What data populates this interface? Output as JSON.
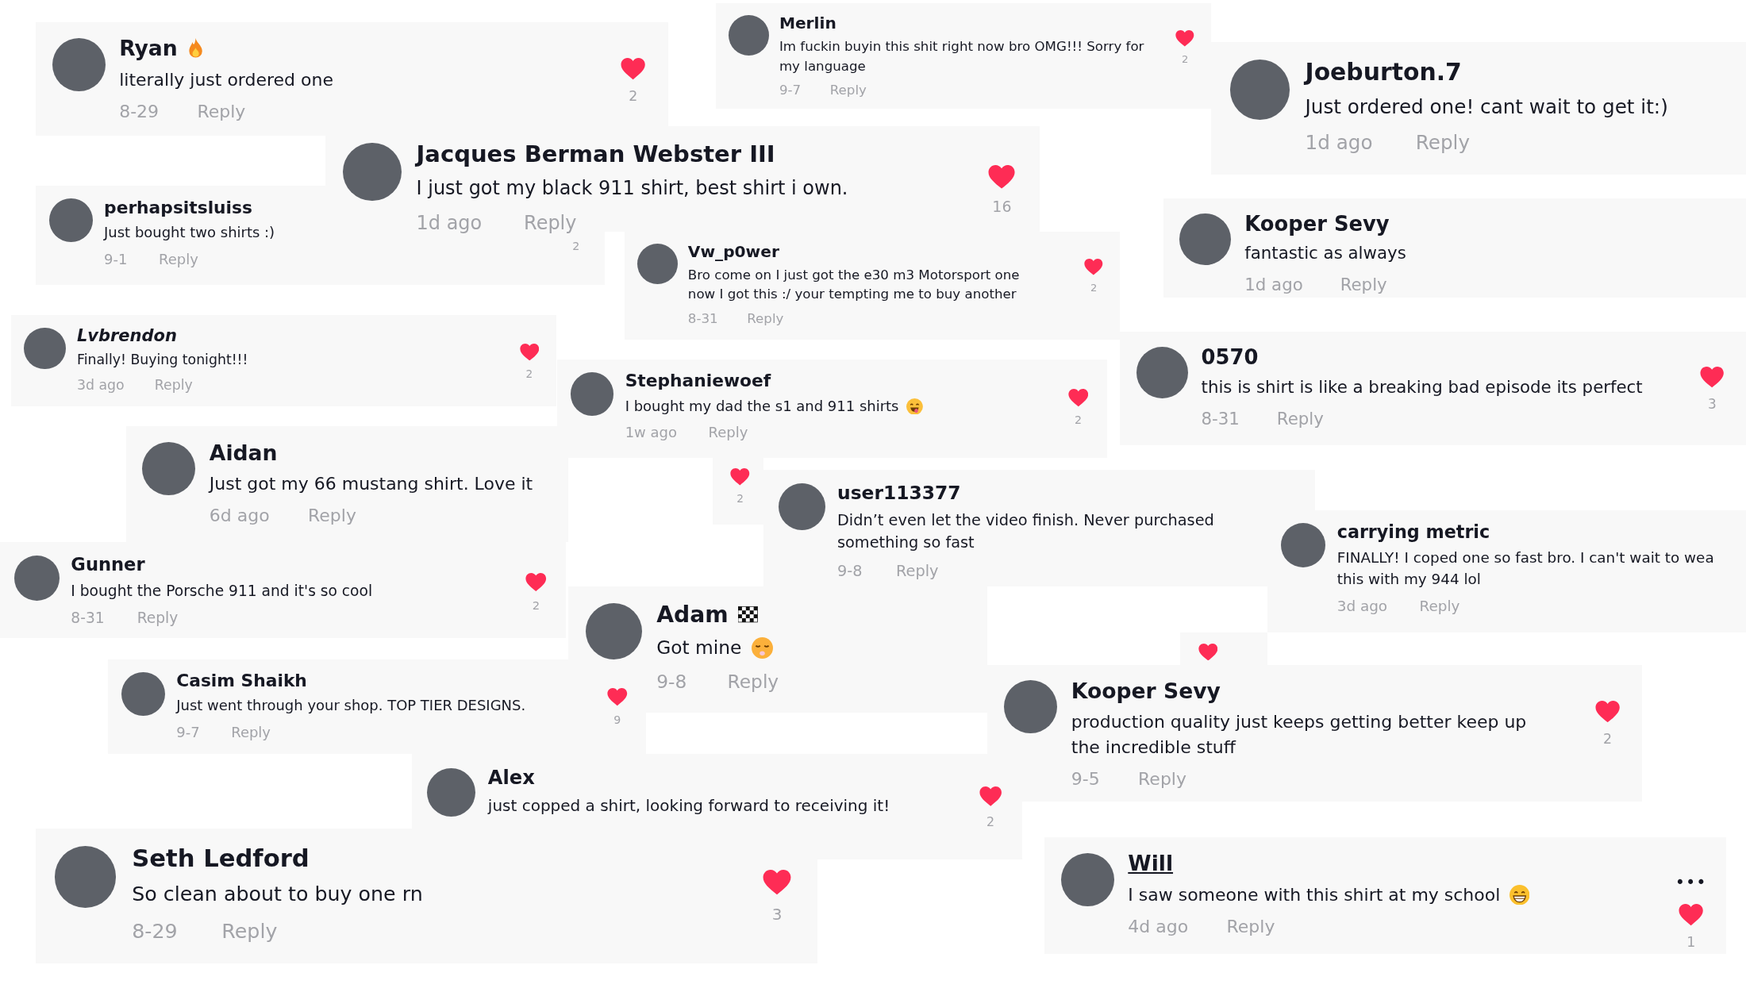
{
  "comments": [
    {
      "kind": "comment",
      "name": "Ryan",
      "name_badge": {
        "kind": "flame"
      },
      "text": "literally just ordered one",
      "date": "8-29",
      "reply": "Reply",
      "likes": {
        "heart": true,
        "count": "2"
      }
    },
    {
      "kind": "comment",
      "name": "Merlin",
      "text": "Im fuckin buyin this shit right now bro OMG!!! Sorry for\nmy language",
      "date": "9-7",
      "reply": "Reply",
      "likes": {
        "heart": true,
        "count": "2"
      }
    },
    {
      "kind": "comment",
      "name": "Joeburton.7",
      "text": "Just ordered one! cant wait to get it:)",
      "date": "1d ago",
      "reply": "Reply"
    },
    {
      "kind": "comment",
      "name": "perhapsitsluiss",
      "text": "Just bought two shirts :)",
      "date": "9-1",
      "reply": "Reply",
      "likes": {
        "heart": false,
        "count": "2"
      }
    },
    {
      "kind": "comment",
      "name": "Jacques Berman Webster III",
      "text": "I just got my black 911 shirt, best shirt i own.",
      "date": "1d ago",
      "reply": "Reply",
      "likes": {
        "heart": true,
        "count": "16"
      }
    },
    {
      "kind": "comment",
      "name": "Vw_p0wer",
      "text": "Bro come on I just got the e30 m3 Motorsport one\nnow I got this :/ your tempting me to buy another",
      "date": "8-31",
      "reply": "Reply",
      "likes": {
        "heart": true,
        "count": "2"
      }
    },
    {
      "kind": "comment",
      "name": "Kooper Sevy",
      "text": "fantastic as always",
      "date": "1d ago",
      "reply": "Reply"
    },
    {
      "kind": "comment",
      "name": "Lvbrendon",
      "name_italic": true,
      "text": "Finally! Buying tonight!!!",
      "date": "3d ago",
      "reply": "Reply",
      "likes": {
        "heart": true,
        "count": "2"
      }
    },
    {
      "kind": "comment",
      "name": "Stephaniewoef",
      "text": "I bought my dad the s1 and 911 shirts",
      "text_emoji": {
        "kind": "tongue"
      },
      "date": "1w ago",
      "reply": "Reply",
      "likes": {
        "heart": true,
        "count": "2"
      }
    },
    {
      "kind": "comment",
      "name": "0570",
      "text": "this is shirt is like a breaking bad episode its perfect",
      "date": "8-31",
      "reply": "Reply",
      "likes": {
        "heart": true,
        "count": "3"
      }
    },
    {
      "kind": "comment",
      "name": "Aidan",
      "text": "Just got my 66 mustang shirt. Love it",
      "date": "6d ago",
      "reply": "Reply"
    },
    {
      "kind": "likes",
      "likes": {
        "heart": true,
        "count": "2"
      }
    },
    {
      "kind": "comment",
      "name": "user113377",
      "text": "Didn’t even let the video finish. Never purchased\nsomething so fast",
      "date": "9-8",
      "reply": "Reply"
    },
    {
      "kind": "comment",
      "name": "carrying metric",
      "text": "FINALLY! I coped one so fast bro. I can't wait to wea\nthis with my 944 lol",
      "date": "3d ago",
      "reply": "Reply"
    },
    {
      "kind": "comment",
      "name": "Gunner",
      "text": "I bought the Porsche 911 and it's so cool",
      "date": "8-31",
      "reply": "Reply",
      "likes": {
        "heart": true,
        "count": "2"
      }
    },
    {
      "kind": "comment",
      "name": "Adam",
      "name_badge": {
        "kind": "flag"
      },
      "text": "Got mine",
      "text_emoji": {
        "kind": "huff"
      },
      "date": "9-8",
      "reply": "Reply"
    },
    {
      "kind": "likes",
      "likes": {
        "heart": true
      }
    },
    {
      "kind": "comment",
      "name": "Kooper Sevy",
      "text": "production quality just keeps getting better keep up\nthe incredible stuff",
      "date": "9-5",
      "reply": "Reply",
      "likes": {
        "heart": true,
        "count": "2"
      }
    },
    {
      "kind": "comment",
      "name": "Casim Shaikh",
      "text": "Just went through your shop. TOP TIER DESIGNS.",
      "date": "9-7",
      "reply": "Reply",
      "likes": {
        "heart": true,
        "count": "9"
      }
    },
    {
      "kind": "comment",
      "name": "Alex",
      "text": "just copped a shirt, looking forward to receiving it!",
      "likes": {
        "heart": true,
        "count": "2"
      }
    },
    {
      "kind": "comment",
      "name": "Seth Ledford",
      "text": "So clean about to buy one rn",
      "date": "8-29",
      "reply": "Reply",
      "likes": {
        "heart": true,
        "count": "3"
      }
    },
    {
      "kind": "comment",
      "name": "Will",
      "name_underlined": true,
      "more": "•••",
      "text": "I saw someone with this shirt at my school",
      "text_emoji": {
        "kind": "grin"
      },
      "date": "4d ago",
      "reply": "Reply",
      "likes": {
        "heart": true,
        "count": "1"
      }
    }
  ]
}
